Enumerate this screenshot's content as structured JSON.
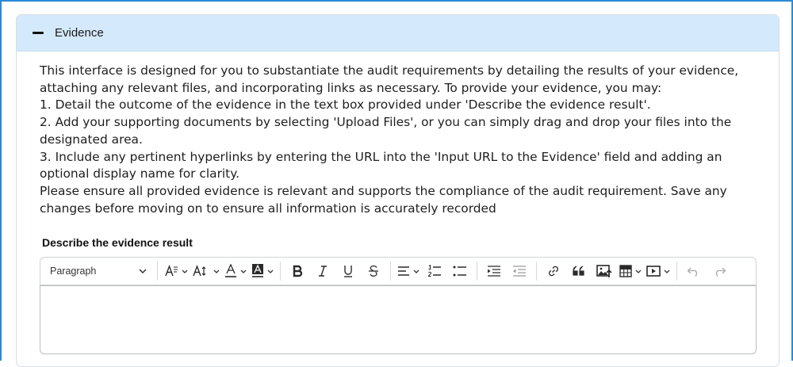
{
  "panel": {
    "title": "Evidence",
    "intro_lines": [
      "This interface is designed for you to substantiate the audit requirements by detailing the results of your evidence, attaching any relevant files, and incorporating links as necessary. To provide your evidence, you may:",
      "1. Detail the outcome of the evidence in the text box provided under 'Describe the evidence result'.",
      "2. Add your supporting documents by selecting 'Upload Files', or you can simply drag and drop your files into the designated area.",
      "3. Include any pertinent hyperlinks by entering the URL into the 'Input URL to the Evidence' field and adding an optional display name for clarity.",
      "Please ensure all provided evidence is relevant and supports the compliance of the audit requirement. Save any changes before moving on to ensure all information is accurately recorded"
    ]
  },
  "editor": {
    "label": "Describe the evidence result",
    "paragraph_select": "Paragraph",
    "value": "",
    "toolbar_icons": [
      "font-size-icon",
      "text-height-icon",
      "font-color-icon",
      "highlight-icon",
      "bold-icon",
      "italic-icon",
      "underline-icon",
      "strikethrough-icon",
      "align-icon",
      "numbered-list-icon",
      "bulleted-list-icon",
      "indent-icon",
      "outdent-icon",
      "link-icon",
      "quote-icon",
      "insert-image-icon",
      "table-icon",
      "media-icon",
      "undo-icon",
      "redo-icon"
    ]
  },
  "colors": {
    "frame_border": "#2b8ad8",
    "header_bg": "#d4e9fb"
  }
}
